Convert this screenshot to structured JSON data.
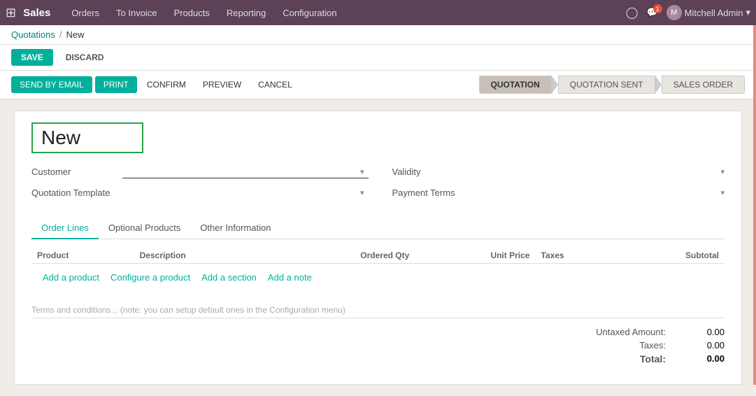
{
  "navbar": {
    "apps_icon": "⊞",
    "brand": "Sales",
    "menu_items": [
      "Orders",
      "To Invoice",
      "Products",
      "Reporting",
      "Configuration"
    ],
    "user_name": "Mitchell Admin",
    "notif_count": "1"
  },
  "breadcrumb": {
    "parent": "Quotations",
    "separator": "/",
    "current": "New"
  },
  "action_bar": {
    "save_label": "SAVE",
    "discard_label": "DISCARD"
  },
  "workflow_bar": {
    "send_by_email_label": "SEND BY EMAIL",
    "print_label": "PRINT",
    "confirm_label": "CONFIRM",
    "preview_label": "PREVIEW",
    "cancel_label": "CANCEL"
  },
  "status_steps": [
    {
      "label": "QUOTATION",
      "active": true
    },
    {
      "label": "QUOTATION SENT",
      "active": false
    },
    {
      "label": "SALES ORDER",
      "active": false
    }
  ],
  "form": {
    "title": "New",
    "left": {
      "customer_label": "Customer",
      "customer_value": "",
      "customer_placeholder": "",
      "quotation_template_label": "Quotation Template",
      "quotation_template_value": ""
    },
    "right": {
      "validity_label": "Validity",
      "validity_value": "",
      "payment_terms_label": "Payment Terms",
      "payment_terms_value": ""
    }
  },
  "tabs": [
    {
      "label": "Order Lines",
      "active": true
    },
    {
      "label": "Optional Products",
      "active": false
    },
    {
      "label": "Other Information",
      "active": false
    }
  ],
  "table": {
    "columns": [
      "Product",
      "Description",
      "Ordered Qty",
      "Unit Price",
      "Taxes",
      "Subtotal"
    ],
    "add_product_label": "Add a product",
    "configure_product_label": "Configure a product",
    "add_section_label": "Add a section",
    "add_note_label": "Add a note"
  },
  "terms": {
    "placeholder": "Terms and conditions... (note: you can setup default ones in the Configuration menu)"
  },
  "totals": {
    "untaxed_label": "Untaxed Amount:",
    "untaxed_value": "0.00",
    "taxes_label": "Taxes:",
    "taxes_value": "0.00",
    "total_label": "Total:",
    "total_value": "0.00"
  }
}
